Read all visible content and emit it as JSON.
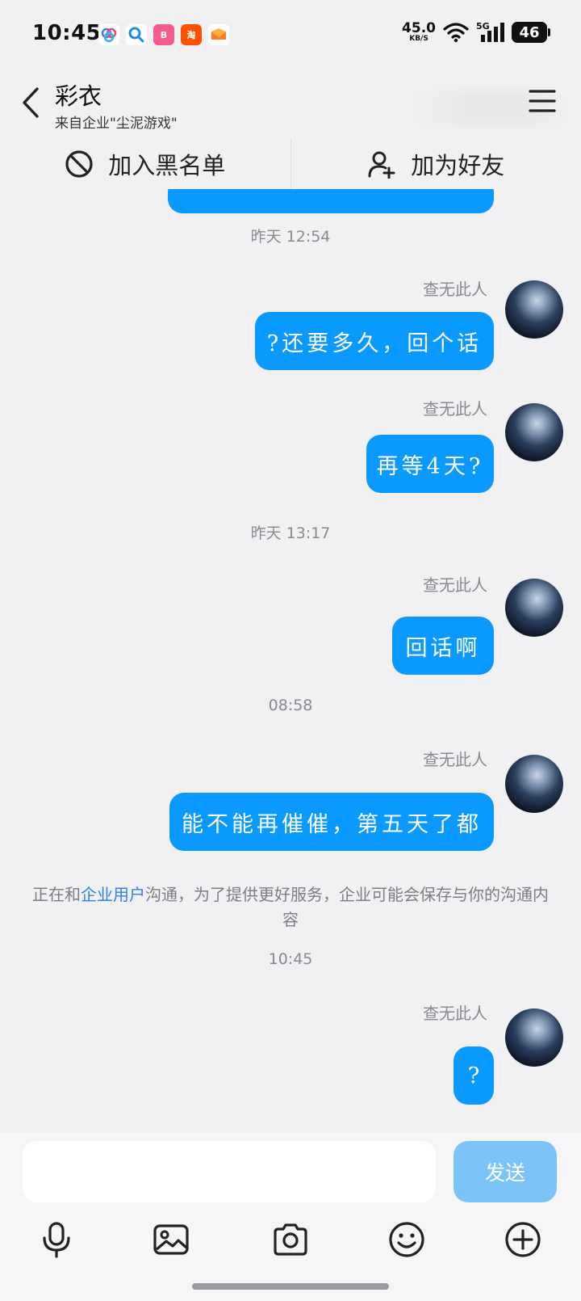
{
  "status_bar": {
    "time": "10:45",
    "net_speed": "45.0",
    "net_unit": "KB/S",
    "network": "5G",
    "battery": "46"
  },
  "header": {
    "title": "彩衣",
    "subtitle": "来自企业\"尘泥游戏\""
  },
  "actions": {
    "blacklist": "加入黑名单",
    "add_friend": "加为好友"
  },
  "chat": {
    "groups": [
      {
        "time": "昨天 12:54",
        "messages": [
          {
            "sender": "查无此人",
            "text": "?还要多久，回个话"
          },
          {
            "sender": "查无此人",
            "text": "再等4天?"
          }
        ]
      },
      {
        "time": "昨天 13:17",
        "messages": [
          {
            "sender": "查无此人",
            "text": "回话啊"
          }
        ]
      },
      {
        "time": "08:58",
        "messages": [
          {
            "sender": "查无此人",
            "text": "能不能再催催，第五天了都"
          }
        ]
      },
      {
        "time": "10:45",
        "messages": [
          {
            "sender": "查无此人",
            "text": "?"
          }
        ]
      }
    ],
    "notice_prefix": "正在和",
    "notice_link": "企业用户",
    "notice_suffix": "沟通，为了提供更好服务，企业可能会保存与你的沟通内容"
  },
  "input": {
    "placeholder": "",
    "send_label": "发送"
  },
  "toolbar": {
    "icons": [
      "microphone-icon",
      "image-icon",
      "camera-icon",
      "emoji-icon",
      "plus-icon"
    ]
  },
  "colors": {
    "bubble": "#0a99ff",
    "send_disabled": "#7cc4f8",
    "link": "#2f7ff0",
    "background": "#f1f1f3"
  }
}
